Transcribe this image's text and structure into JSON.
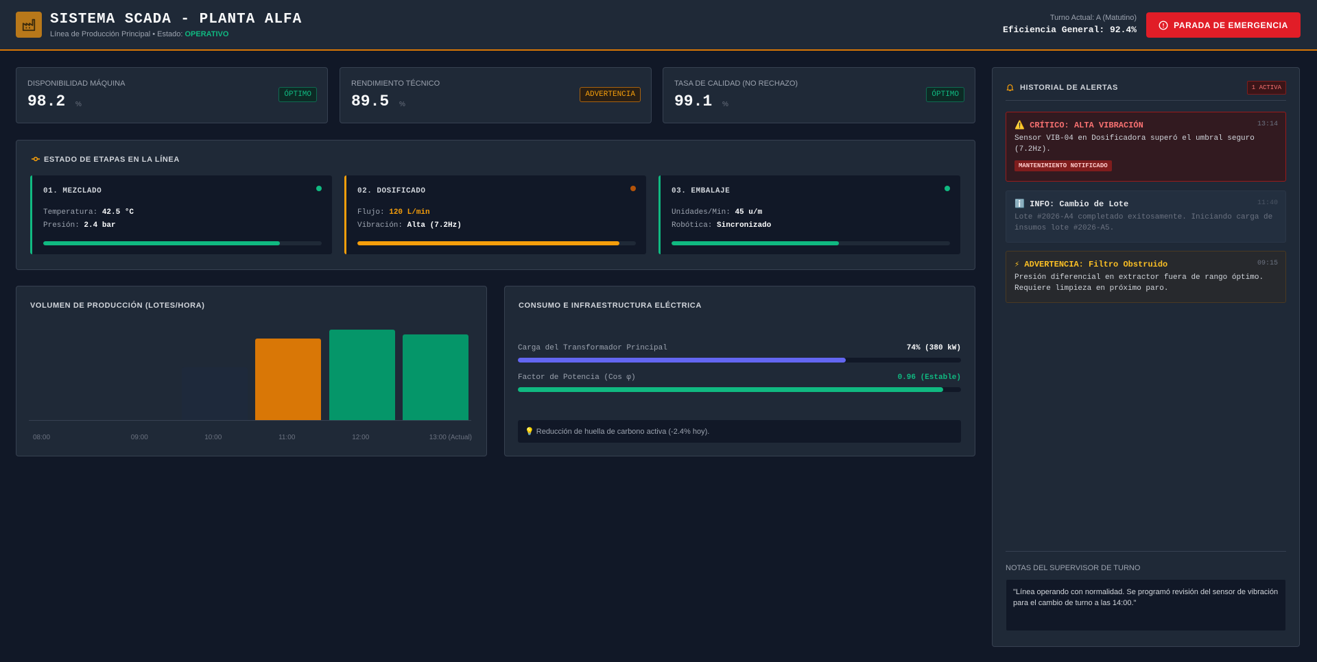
{
  "header": {
    "title": "SISTEMA SCADA - PLANTA ALFA",
    "subtitle_prefix": "Línea de Producción Principal • Estado: ",
    "status": "OPERATIVO",
    "shift": "Turno Actual: A (Matutino)",
    "efficiency": "Eficiencia General: 92.4%",
    "emergency_button": "PARADA DE EMERGENCIA"
  },
  "kpis": [
    {
      "label": "DISPONIBILIDAD MÁQUINA",
      "value": "98.2",
      "unit": "%",
      "badge": "ÓPTIMO"
    },
    {
      "label": "RENDIMIENTO TÉCNICO",
      "value": "89.5",
      "unit": "%",
      "badge": "ADVERTENCIA"
    },
    {
      "label": "TASA DE CALIDAD (NO RECHAZO)",
      "value": "99.1",
      "unit": "%",
      "badge": "ÓPTIMO"
    }
  ],
  "stages": {
    "title": "ESTADO DE ETAPAS EN LA LÍNEA",
    "items": [
      {
        "title": "01. MEZCLADO",
        "l1": "Temperatura:",
        "v1": "42.5 °C",
        "l2": "Presión:",
        "v2": "2.4 bar",
        "progress": 0.85
      },
      {
        "title": "02. DOSIFICADO",
        "l1": "Flujo:",
        "v1": "120 L/min",
        "l2": "Vibración:",
        "v2": "Alta (7.2Hz)",
        "progress": 0.94
      },
      {
        "title": "03. EMBALAJE",
        "l1": "Unidades/Min:",
        "v1": "45 u/m",
        "l2": "Robótica:",
        "v2": "Sincronizado",
        "progress": 0.6
      }
    ]
  },
  "production": {
    "title": "VOLUMEN DE PRODUCCIÓN (LOTES/HORA)"
  },
  "chart_data": {
    "type": "bar",
    "categories": [
      "08:00",
      "09:00",
      "10:00",
      "11:00",
      "12:00",
      "13:00 (Actual)"
    ],
    "values": [
      0,
      0,
      58,
      90,
      100,
      95
    ],
    "ylim": [
      0,
      100
    ],
    "colors": [
      "#1f2937",
      "#1f2937",
      "#1e293b",
      "#d97706",
      "#059669",
      "#059669"
    ]
  },
  "power": {
    "title": "CONSUMO E INFRAESTRUCTURA ELÉCTRICA",
    "transformer_label": "Carga del Transformador Principal",
    "transformer_value": "74% (380 kW)",
    "transformer_level": 0.74,
    "pf_label": "Factor de Potencia (Cos φ)",
    "pf_value": "0.96 (Estable)",
    "pf_level": 0.96,
    "note": "💡 Reducción de huella de carbono activa (-2.4% hoy)."
  },
  "alerts": {
    "title": "HISTORIAL DE ALERTAS",
    "badge": "1 ACTIVA",
    "items": [
      {
        "title": "⚠️ CRÍTICO: ALTA VIBRACIÓN",
        "time": "13:14",
        "body": "Sensor VIB-04 en Dosificadora superó el umbral seguro (7.2Hz).",
        "tag": "MANTENIMIENTO NOTIFICADO"
      },
      {
        "title": "ℹ️ INFO: Cambio de Lote",
        "time": "11:40",
        "body": "Lote #2026-A4 completado exitosamente. Iniciando carga de insumos lote #2026-A5."
      },
      {
        "title": "⚡ ADVERTENCIA: Filtro Obstruido",
        "time": "09:15",
        "body": "Presión diferencial en extractor fuera de rango óptimo. Requiere limpieza en próximo paro."
      }
    ],
    "notes_title": "NOTAS DEL SUPERVISOR DE TURNO",
    "notes": "\"Línea operando con normalidad. Se programó revisión del sensor de vibración para el cambio de turno a las 14:00.\""
  }
}
